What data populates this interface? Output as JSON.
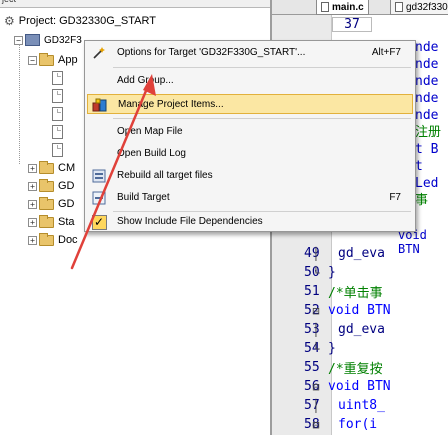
{
  "project_panel": {
    "tab_fragment": "ject",
    "project_label": "Project: GD32330G_START",
    "target_label": "GD32F3",
    "tree": [
      {
        "label": "App",
        "type": "folder",
        "expander": "−"
      },
      {
        "label": "",
        "type": "file"
      },
      {
        "label": "",
        "type": "file"
      },
      {
        "label": "",
        "type": "file"
      },
      {
        "label": "",
        "type": "file"
      },
      {
        "label": "",
        "type": "file"
      },
      {
        "label": "CM",
        "type": "folder",
        "expander": "+"
      },
      {
        "label": "GD",
        "type": "folder",
        "expander": "+"
      },
      {
        "label": "GD",
        "type": "folder",
        "expander": "+"
      },
      {
        "label": "Sta",
        "type": "folder",
        "expander": "+"
      },
      {
        "label": "Doc",
        "type": "folder",
        "expander": "+"
      }
    ]
  },
  "editor": {
    "tabs": [
      {
        "label": "main.c"
      },
      {
        "label": "gd32f330"
      }
    ],
    "top_line_number": "37",
    "lines": [
      {
        "n": "49",
        "mk": "│",
        "code": "gd_eva"
      },
      {
        "n": "50",
        "mk": "└",
        "code": "}"
      },
      {
        "n": "51",
        "mk": "",
        "code": "/*单击事"
      },
      {
        "n": "52",
        "mk": "⊟",
        "code": "void BTN"
      },
      {
        "n": "53",
        "mk": "│",
        "code": "gd_eva"
      },
      {
        "n": "54",
        "mk": "└",
        "code": "}"
      },
      {
        "n": "55",
        "mk": "",
        "code": "/*重复按"
      },
      {
        "n": "56",
        "mk": "⊟",
        "code": "void BTN"
      },
      {
        "n": "57",
        "mk": "│",
        "code": "uint8_"
      },
      {
        "n": "58",
        "mk": "⊟",
        "code": "for(i"
      }
    ],
    "partial_right": [
      "nde",
      "nde",
      "nde",
      "nde",
      "nde",
      "注册",
      "t B",
      "t",
      "Led",
      "事",
      "BTN"
    ],
    "partial_line_48": "void BTN"
  },
  "context_menu": {
    "items": [
      {
        "label": "Options for Target 'GD32F330G_START'...",
        "shortcut": "Alt+F7",
        "icon": "wand-icon"
      },
      {
        "label": "Add Group...",
        "shortcut": "",
        "icon": ""
      },
      {
        "label": "Manage Project Items...",
        "shortcut": "",
        "icon": "project-items-icon",
        "highlighted": true
      },
      {
        "label": "Open Map File",
        "shortcut": "",
        "icon": ""
      },
      {
        "label": "Open Build Log",
        "shortcut": "",
        "icon": ""
      },
      {
        "label": "Rebuild all target files",
        "shortcut": "",
        "icon": "rebuild-icon"
      },
      {
        "label": "Build Target",
        "shortcut": "F7",
        "icon": "build-icon"
      },
      {
        "label": "Show Include File Dependencies",
        "shortcut": "",
        "icon": "checkbox-icon",
        "checked": true
      }
    ]
  },
  "colors": {
    "highlight": "#fbe7a3",
    "arrow": "#e0413a",
    "line_numbers": "#000080"
  }
}
